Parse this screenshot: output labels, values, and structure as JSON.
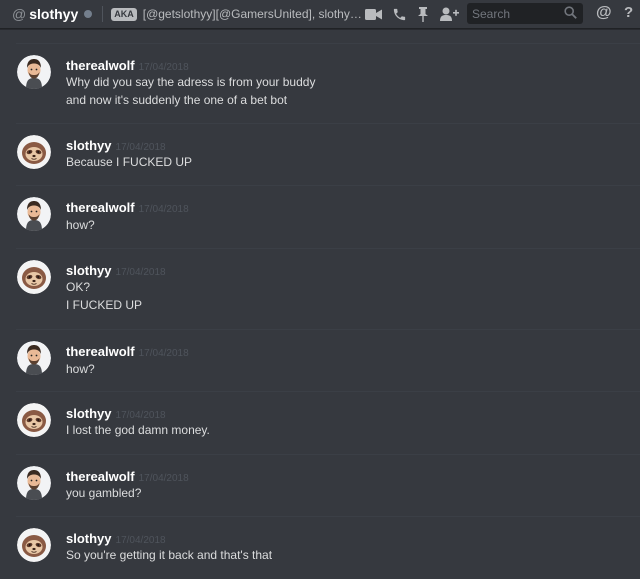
{
  "header": {
    "at_symbol": "@",
    "username": "slothyy",
    "aka_badge": "AKA",
    "aka_names": "[@getslothyy][@GamersUnited], slothyy [@g...",
    "search_placeholder": "Search",
    "mention_label": "@",
    "help_label": "?",
    "icons": [
      "video-call-icon",
      "voice-call-icon",
      "pin-icon",
      "add-friend-icon",
      "search-icon"
    ]
  },
  "colors": {
    "background": "#36393f",
    "author": "#ffffff",
    "message_text": "#dcddde",
    "timestamp": "#4f545c",
    "status_offline": "#747f8d"
  },
  "messages": [
    {
      "author": "therealwolf",
      "avatar": "man-avatar",
      "timestamp": "17/04/2018",
      "lines": [
        "Why did you say the adress is from your buddy",
        "and now it's suddenly the one of a bet  bot"
      ]
    },
    {
      "author": "slothyy",
      "avatar": "sloth-avatar",
      "timestamp": "17/04/2018",
      "lines": [
        "Because I FUCKED UP"
      ]
    },
    {
      "author": "therealwolf",
      "avatar": "man-avatar",
      "timestamp": "17/04/2018",
      "lines": [
        "how?"
      ]
    },
    {
      "author": "slothyy",
      "avatar": "sloth-avatar",
      "timestamp": "17/04/2018",
      "lines": [
        "OK?",
        "I FUCKED UP"
      ]
    },
    {
      "author": "therealwolf",
      "avatar": "man-avatar",
      "timestamp": "17/04/2018",
      "lines": [
        "how?"
      ]
    },
    {
      "author": "slothyy",
      "avatar": "sloth-avatar",
      "timestamp": "17/04/2018",
      "lines": [
        "I lost the god damn money."
      ]
    },
    {
      "author": "therealwolf",
      "avatar": "man-avatar",
      "timestamp": "17/04/2018",
      "lines": [
        "you gambled?"
      ]
    },
    {
      "author": "slothyy",
      "avatar": "sloth-avatar",
      "timestamp": "17/04/2018",
      "lines": [
        "So you're getting it back and that's that"
      ]
    }
  ]
}
